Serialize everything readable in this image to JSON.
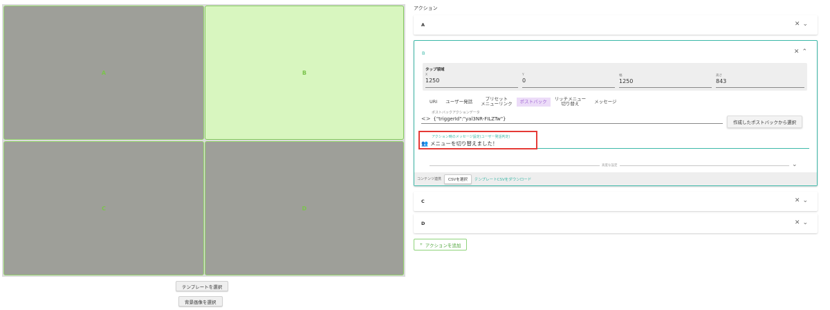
{
  "grid": {
    "cells": [
      {
        "label": "A"
      },
      {
        "label": "B"
      },
      {
        "label": "C"
      },
      {
        "label": "D"
      }
    ]
  },
  "buttons": {
    "select_template": "テンプレートを選択",
    "select_background": "背景画像を選択"
  },
  "actions": {
    "title": "アクション",
    "add_label": "アクションを追加",
    "cards": [
      {
        "label": "A"
      },
      {
        "label": "B",
        "tap_area": {
          "title": "タップ領域",
          "x_label": "X",
          "x_value": "1250",
          "y_label": "Y",
          "y_value": "0",
          "w_label": "幅",
          "w_value": "1250",
          "h_label": "高さ",
          "h_value": "843"
        },
        "tabs": [
          "URI",
          "ユーザー発話",
          "プリセット\nメニューリンク",
          "ポストバック",
          "リッチメニュー\n切り替え",
          "メッセージ"
        ],
        "postback": {
          "label": "ポストバックアクションデータ",
          "value": "{\"triggerId\":\"yal3NR-FILZTw\"}",
          "select_button": "作成したポストバックから選択"
        },
        "message": {
          "label": "アクション時のメッセージ設定(ユーザー発話判定)",
          "value": "メニューを切り替えました！"
        },
        "advanced_label": "高度な設定",
        "footer": {
          "label": "コンテンツ連携",
          "csv_button": "CSVを選択",
          "download_link": "テンプレートCSVをダウンロード"
        }
      },
      {
        "label": "C"
      },
      {
        "label": "D"
      }
    ]
  },
  "icons": {
    "close": "✕",
    "expand": "⌄",
    "collapse": "⌃",
    "plus": "+",
    "code": "<>",
    "person": "👥"
  }
}
